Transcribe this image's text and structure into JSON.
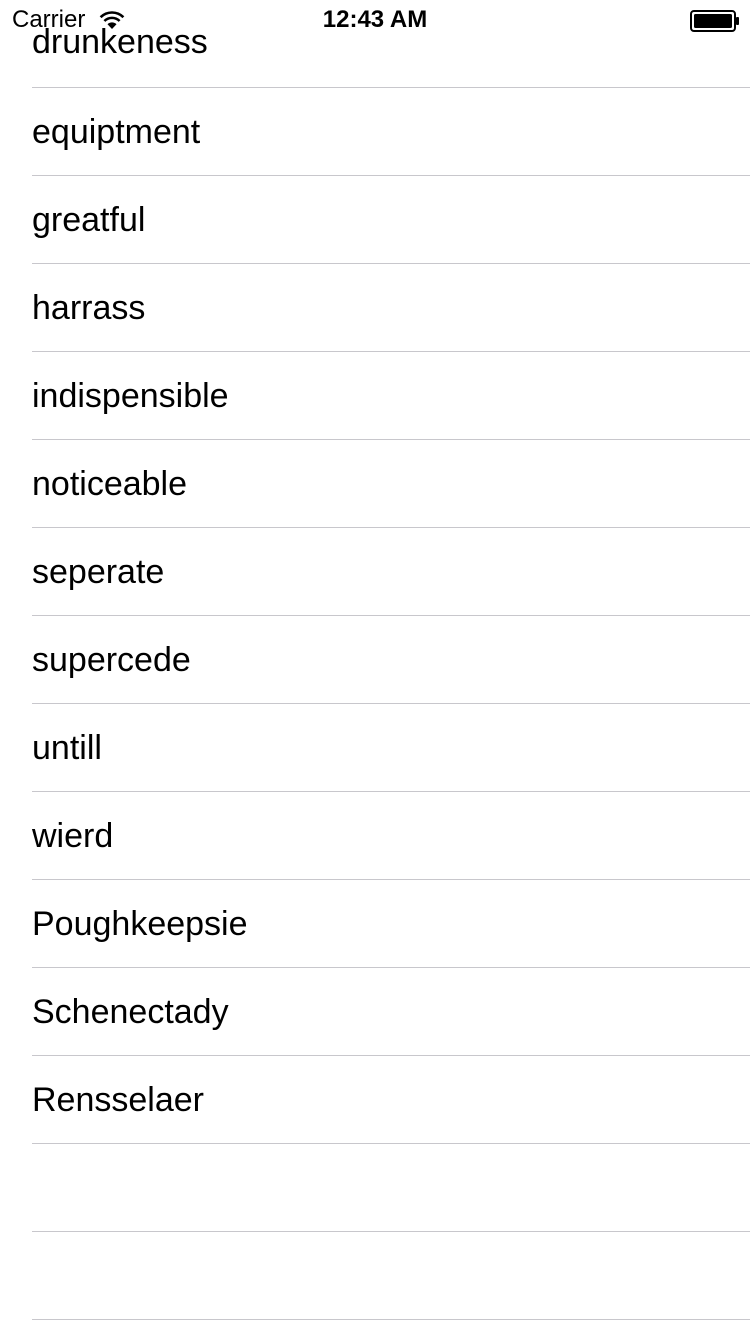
{
  "status_bar": {
    "carrier": "Carrier",
    "wifi_icon": "wifi-icon",
    "time": "12:43 AM",
    "battery_icon": "battery-icon"
  },
  "list": {
    "items": [
      "drunkeness",
      "equiptment",
      "greatful",
      "harrass",
      "indispensible",
      "noticeable",
      "seperate",
      "supercede",
      "untill",
      "wierd",
      "Poughkeepsie",
      "Schenectady",
      "Rensselaer",
      "",
      ""
    ]
  },
  "colors": {
    "separator": "#c8c7cc",
    "text": "#000000",
    "background": "#ffffff"
  }
}
